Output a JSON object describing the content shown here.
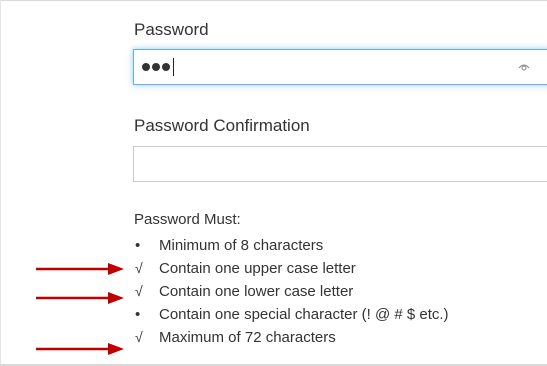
{
  "form": {
    "password_label": "Password",
    "password_mask_count": 3,
    "password_toggle_icon": "eye-icon",
    "confirm_label": "Password Confirmation",
    "confirm_value": ""
  },
  "requirements": {
    "title": "Password Must:",
    "items": [
      {
        "mark": "•",
        "met": false,
        "text": "Minimum of 8 characters"
      },
      {
        "mark": "√",
        "met": true,
        "text": "Contain one upper case letter"
      },
      {
        "mark": "√",
        "met": true,
        "text": "Contain one lower case letter"
      },
      {
        "mark": "•",
        "met": false,
        "text": "Contain one special character (! @ # $ etc.)"
      },
      {
        "mark": "√",
        "met": true,
        "text": "Maximum of 72 characters"
      }
    ]
  },
  "annotations": {
    "arrow_color": "#c00000",
    "arrow_icon": "red-arrow-right-icon",
    "arrow_targets": [
      1,
      2,
      4
    ]
  },
  "colors": {
    "focus_border": "#66afe9",
    "text": "#333333"
  }
}
